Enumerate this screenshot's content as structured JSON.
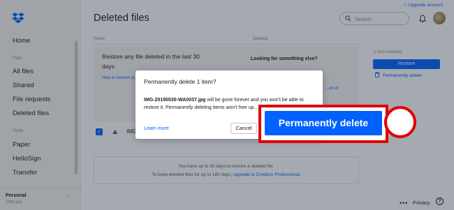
{
  "sidebar": {
    "logo": "dropbox-logo",
    "items": [
      {
        "label": "Home"
      },
      {
        "label": "All files"
      },
      {
        "label": "Shared"
      },
      {
        "label": "File requests"
      },
      {
        "label": "Deleted files"
      },
      {
        "label": "Paper"
      },
      {
        "label": "HelloSign"
      },
      {
        "label": "Transfer"
      }
    ],
    "section_files": "Files",
    "section_tools": "Tools",
    "account": {
      "name": "Personal",
      "sub": "Only you"
    }
  },
  "header": {
    "title": "Deleted files",
    "upgrade_label": "Upgrade account",
    "search_placeholder": "Search"
  },
  "table": {
    "col_name": "Name",
    "col_deleted": "Deleted"
  },
  "info": {
    "restore_text": "Restore any file deleted in the last 30 days",
    "how_to_link": "How to recover d... files",
    "looking_title": "Looking for something else?",
    "right_link": "...on of"
  },
  "file": {
    "name": "IMG-201..."
  },
  "footer": {
    "line1": "You have up to 30 days to restore a deleted file.",
    "line2_prefix": "To keep deleted files for up to 180 days,",
    "line2_link": "upgrade to Dropbox Professional."
  },
  "right_panel": {
    "selected_count": "1 item selected",
    "restore_label": "Restore",
    "perm_delete_label": "Permanently delete"
  },
  "bottom": {
    "more": "•••",
    "privacy": "Privacy",
    "help": "?"
  },
  "modal": {
    "title": "Permanently delete 1 item?",
    "file_name": "IMG-20190530-WA0037.jpg",
    "body_rest": " will be gone forever and you won't be able to restore it. Permanently deleting items won't free up...",
    "learn_more": "Learn more",
    "cancel_label": "Cancel",
    "confirm_label": "Permanently delete"
  },
  "colors": {
    "accent": "#0061fe",
    "highlight": "#e00000"
  }
}
